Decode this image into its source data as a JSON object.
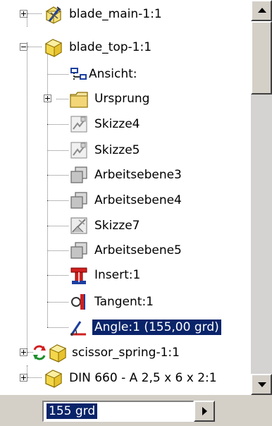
{
  "tree": {
    "items": [
      {
        "label": "blade_main-1:1",
        "icon": "part-edit-icon",
        "expander": "plus"
      },
      {
        "label": "blade_top-1:1",
        "icon": "part-icon",
        "expander": "minus"
      },
      {
        "label": "Ansicht:",
        "icon": "view-icon"
      },
      {
        "label": "Ursprung",
        "icon": "folder-icon",
        "expander": "plus"
      },
      {
        "label": "Skizze4",
        "icon": "sketch-icon"
      },
      {
        "label": "Skizze5",
        "icon": "sketch-icon"
      },
      {
        "label": "Arbeitsebene3",
        "icon": "work-plane-icon"
      },
      {
        "label": "Arbeitsebene4",
        "icon": "work-plane-icon"
      },
      {
        "label": "Skizze7",
        "icon": "sketch-3d-icon"
      },
      {
        "label": "Arbeitsebene5",
        "icon": "work-plane-icon"
      },
      {
        "label": "Insert:1",
        "icon": "insert-constraint-icon"
      },
      {
        "label": "Tangent:1",
        "icon": "tangent-constraint-icon"
      },
      {
        "label": "Angle:1 (155,00 grd)",
        "icon": "angle-constraint-icon",
        "selected": true
      },
      {
        "label": "scissor_spring-1:1",
        "icon": "adaptive-part-icon",
        "expander": "plus"
      },
      {
        "label": "DIN 660 - A 2,5 x 6 x 2:1",
        "icon": "part-icon",
        "expander": "plus"
      }
    ]
  },
  "value_editor": {
    "value": "155 grd",
    "button_icon": "arrow-right-icon"
  },
  "colors": {
    "selection": "#0a246a",
    "part_yellow": "#f6e27a",
    "chrome": "#d4d0c8"
  }
}
